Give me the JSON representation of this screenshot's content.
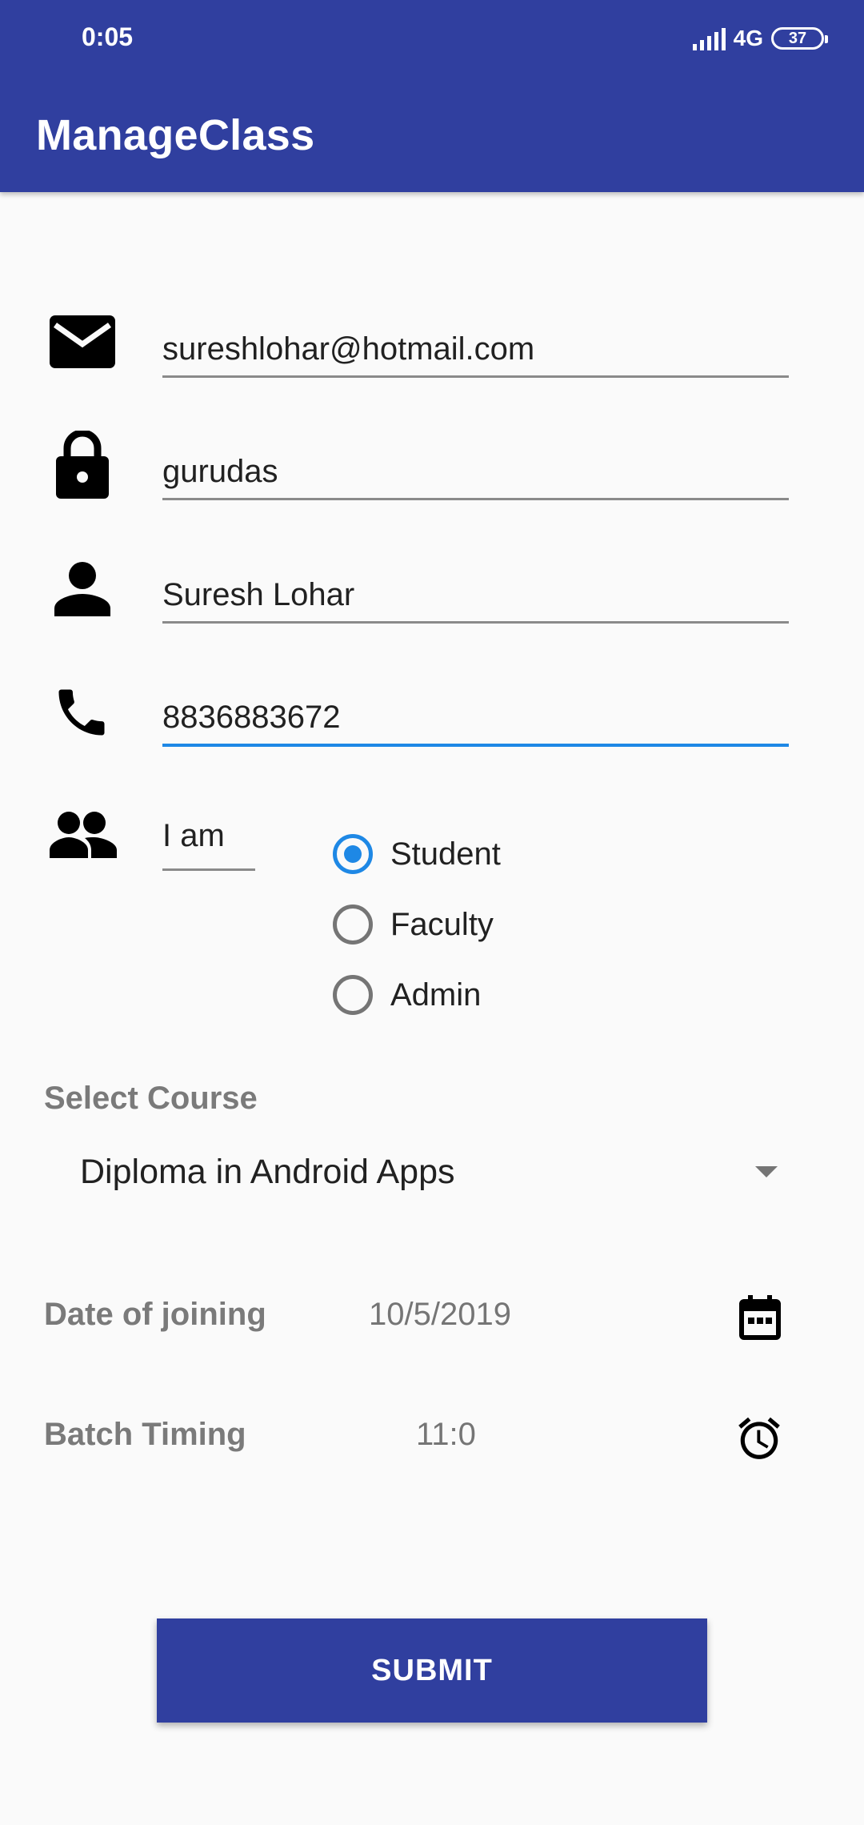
{
  "status_bar": {
    "time": "0:05",
    "network": "4G",
    "battery": "37"
  },
  "app": {
    "title": "ManageClass"
  },
  "form": {
    "email": "sureshlohar@hotmail.com",
    "password": "gurudas",
    "name": "Suresh Lohar",
    "phone": "8836883672",
    "role_label": "I am",
    "roles": [
      {
        "label": "Student",
        "checked": true
      },
      {
        "label": "Faculty",
        "checked": false
      },
      {
        "label": "Admin",
        "checked": false
      }
    ],
    "course_label": "Select Course",
    "course_value": "Diploma in Android Apps",
    "date_label": "Date of joining",
    "date_value": "10/5/2019",
    "time_label": "Batch Timing",
    "time_value": "11:0",
    "submit_label": "SUBMIT"
  },
  "colors": {
    "primary": "#303f9f",
    "accent": "#1e88e5"
  },
  "icons": [
    "email-icon",
    "lock-icon",
    "person-icon",
    "phone-icon",
    "people-icon",
    "calendar-icon",
    "alarm-icon",
    "dropdown-arrow-icon"
  ]
}
